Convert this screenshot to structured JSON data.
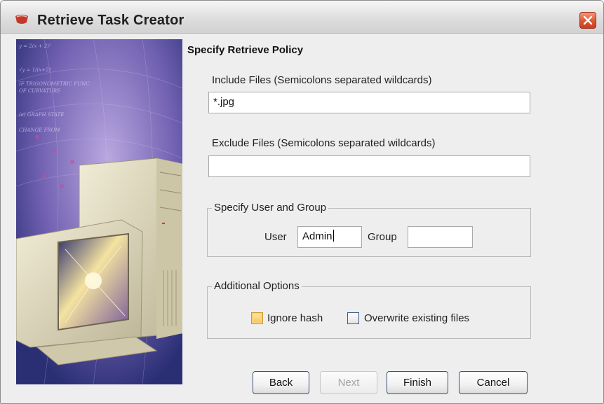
{
  "window": {
    "title": "Retrieve Task Creator",
    "icon": "java-cup-icon"
  },
  "page": {
    "section_title": "Specify Retrieve Policy"
  },
  "include": {
    "label": "Include Files (Semicolons separated wildcards)",
    "value": "*.jpg"
  },
  "exclude": {
    "label": "Exclude Files (Semicolons separated wildcards)",
    "value": ""
  },
  "user_group": {
    "legend": "Specify User and Group",
    "user_label": "User",
    "user_value": "Admin",
    "group_label": "Group",
    "group_value": ""
  },
  "options": {
    "legend": "Additional Options",
    "ignore_hash_label": "Ignore hash",
    "ignore_hash_checked": false,
    "overwrite_label": "Overwrite existing files",
    "overwrite_checked": false
  },
  "buttons": {
    "back": "Back",
    "next": "Next",
    "next_enabled": false,
    "finish": "Finish",
    "cancel": "Cancel"
  },
  "colors": {
    "close_button": "#dd5533",
    "focus_highlight": "#f7c25a",
    "button_border": "#3c4f79"
  }
}
